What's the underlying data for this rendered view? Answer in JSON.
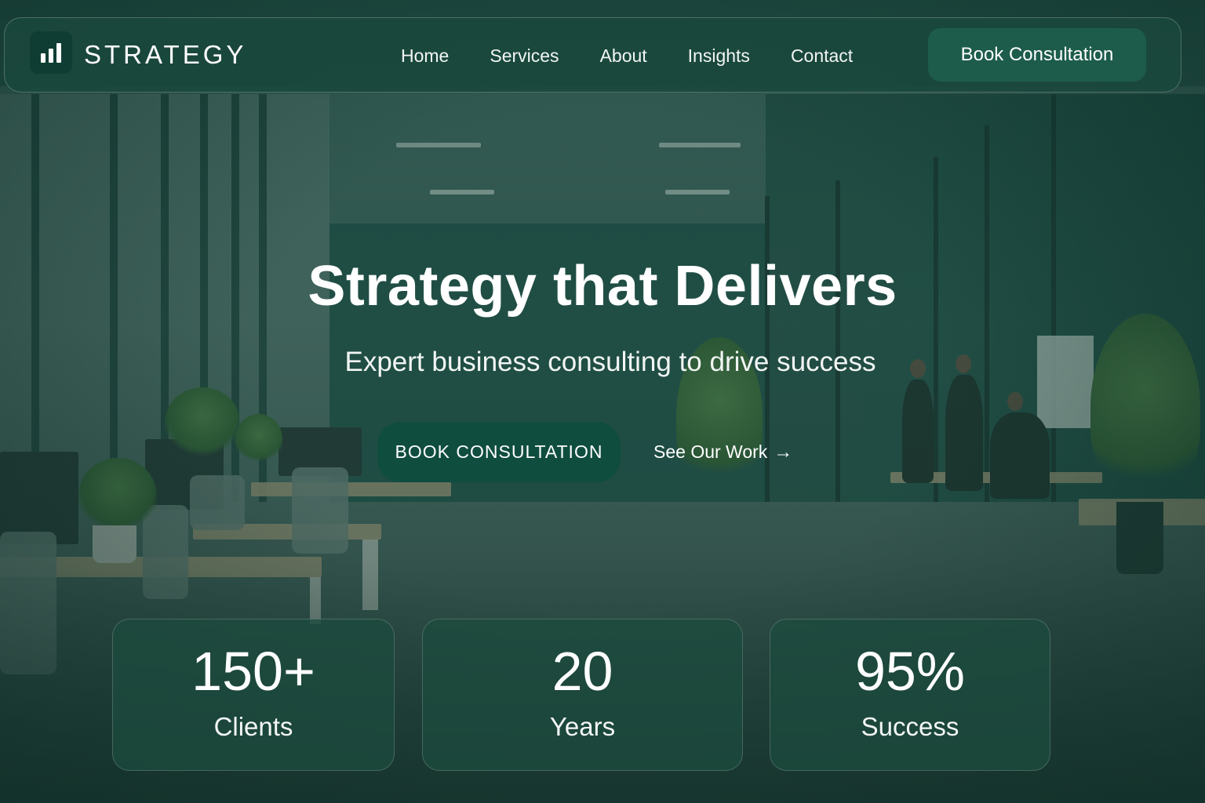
{
  "brand": {
    "name": "STRATEGY",
    "logo_icon": "bar-chart-icon"
  },
  "nav": {
    "links": [
      "Home",
      "Services",
      "About",
      "Insights",
      "Contact"
    ],
    "cta_label": "Book Consultation"
  },
  "hero": {
    "title": "Strategy that Delivers",
    "subtitle": "Expert business consulting to drive success",
    "primary_button": "BOOK CONSULTATION",
    "secondary_link": "See Our Work",
    "secondary_icon": "arrow-right-icon"
  },
  "stats": [
    {
      "value": "150+",
      "label": "Clients"
    },
    {
      "value": "20",
      "label": "Years"
    },
    {
      "value": "95%",
      "label": "Success"
    }
  ],
  "colors": {
    "accent": "#0f4d3f",
    "nav_background": "#1a483c",
    "nav_cta": "#1d5c4b",
    "text": "#ffffff"
  }
}
